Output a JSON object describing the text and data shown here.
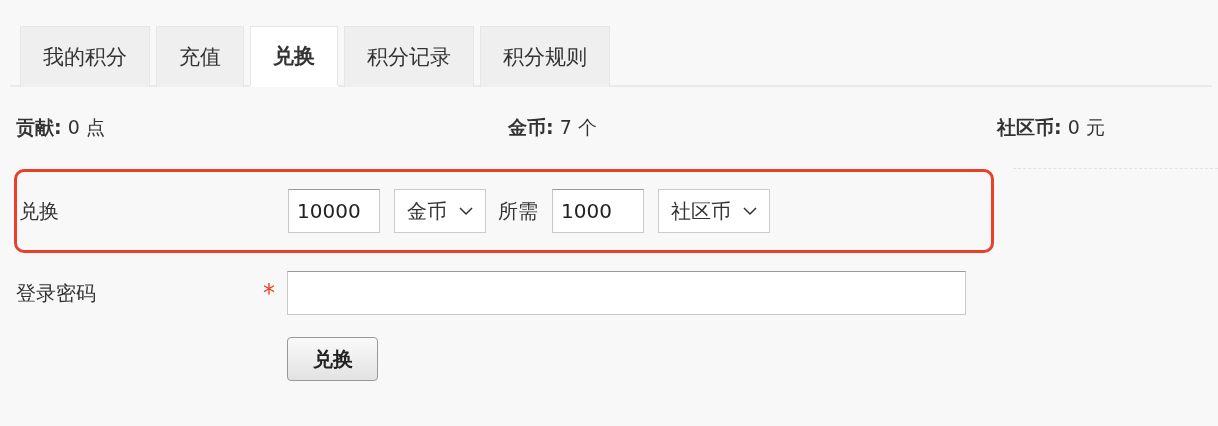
{
  "tabs": [
    {
      "label": "我的积分",
      "selected": false
    },
    {
      "label": "充值",
      "selected": false
    },
    {
      "label": "兑换",
      "selected": true
    },
    {
      "label": "积分记录",
      "selected": false
    },
    {
      "label": "积分规则",
      "selected": false
    }
  ],
  "stats": [
    "**贡献:** 0 点",
    "**金币:** 7 个",
    "**社区币:** 0 元"
  ],
  "exchange": {
    "label": "兑换",
    "highlighted": true,
    "amount": "10000",
    "from_currency": "金币",
    "required_label": "所需",
    "required_amount": "1000",
    "to_currency": "社区币"
  },
  "password": {
    "label": "登录密码",
    "required": true,
    "required_mark": "*"
  },
  "submit": "兑换"
}
